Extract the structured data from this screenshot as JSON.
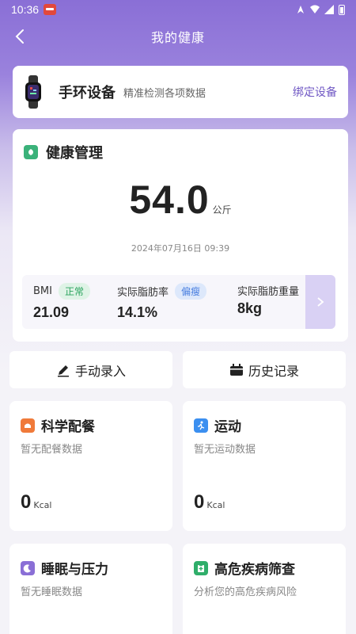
{
  "status": {
    "time": "10:36"
  },
  "nav": {
    "title": "我的健康"
  },
  "device": {
    "name": "手环设备",
    "subtitle": "精准检测各项数据",
    "bind_label": "绑定设备"
  },
  "health": {
    "title": "健康管理",
    "weight_value": "54.0",
    "weight_unit": "公斤",
    "date": "2024年07月16日 09:39",
    "metrics": [
      {
        "label": "BMI",
        "badge": "正常",
        "value": "21.09"
      },
      {
        "label": "实际脂肪率",
        "badge": "偏瘦",
        "value": "14.1%"
      },
      {
        "label": "实际脂肪重量",
        "value": "8kg"
      }
    ]
  },
  "actions": {
    "manual": "手动录入",
    "history": "历史记录"
  },
  "tiles": {
    "diet": {
      "title": "科学配餐",
      "subtitle": "暂无配餐数据",
      "value": "0",
      "unit": "Kcal"
    },
    "sport": {
      "title": "运动",
      "subtitle": "暂无运动数据",
      "value": "0",
      "unit": "Kcal"
    },
    "sleep": {
      "title": "睡眠与压力",
      "subtitle": "暂无睡眠数据"
    },
    "risk": {
      "title": "高危疾病筛查",
      "subtitle": "分析您的高危疾病风险"
    }
  },
  "colors": {
    "accent": "#7058c4",
    "health_icon": "#3bb27a",
    "diet_icon": "#f07a3a",
    "sport_icon": "#3b8ff0",
    "sleep_icon": "#8a6fd6",
    "risk_icon": "#2fae6a"
  }
}
